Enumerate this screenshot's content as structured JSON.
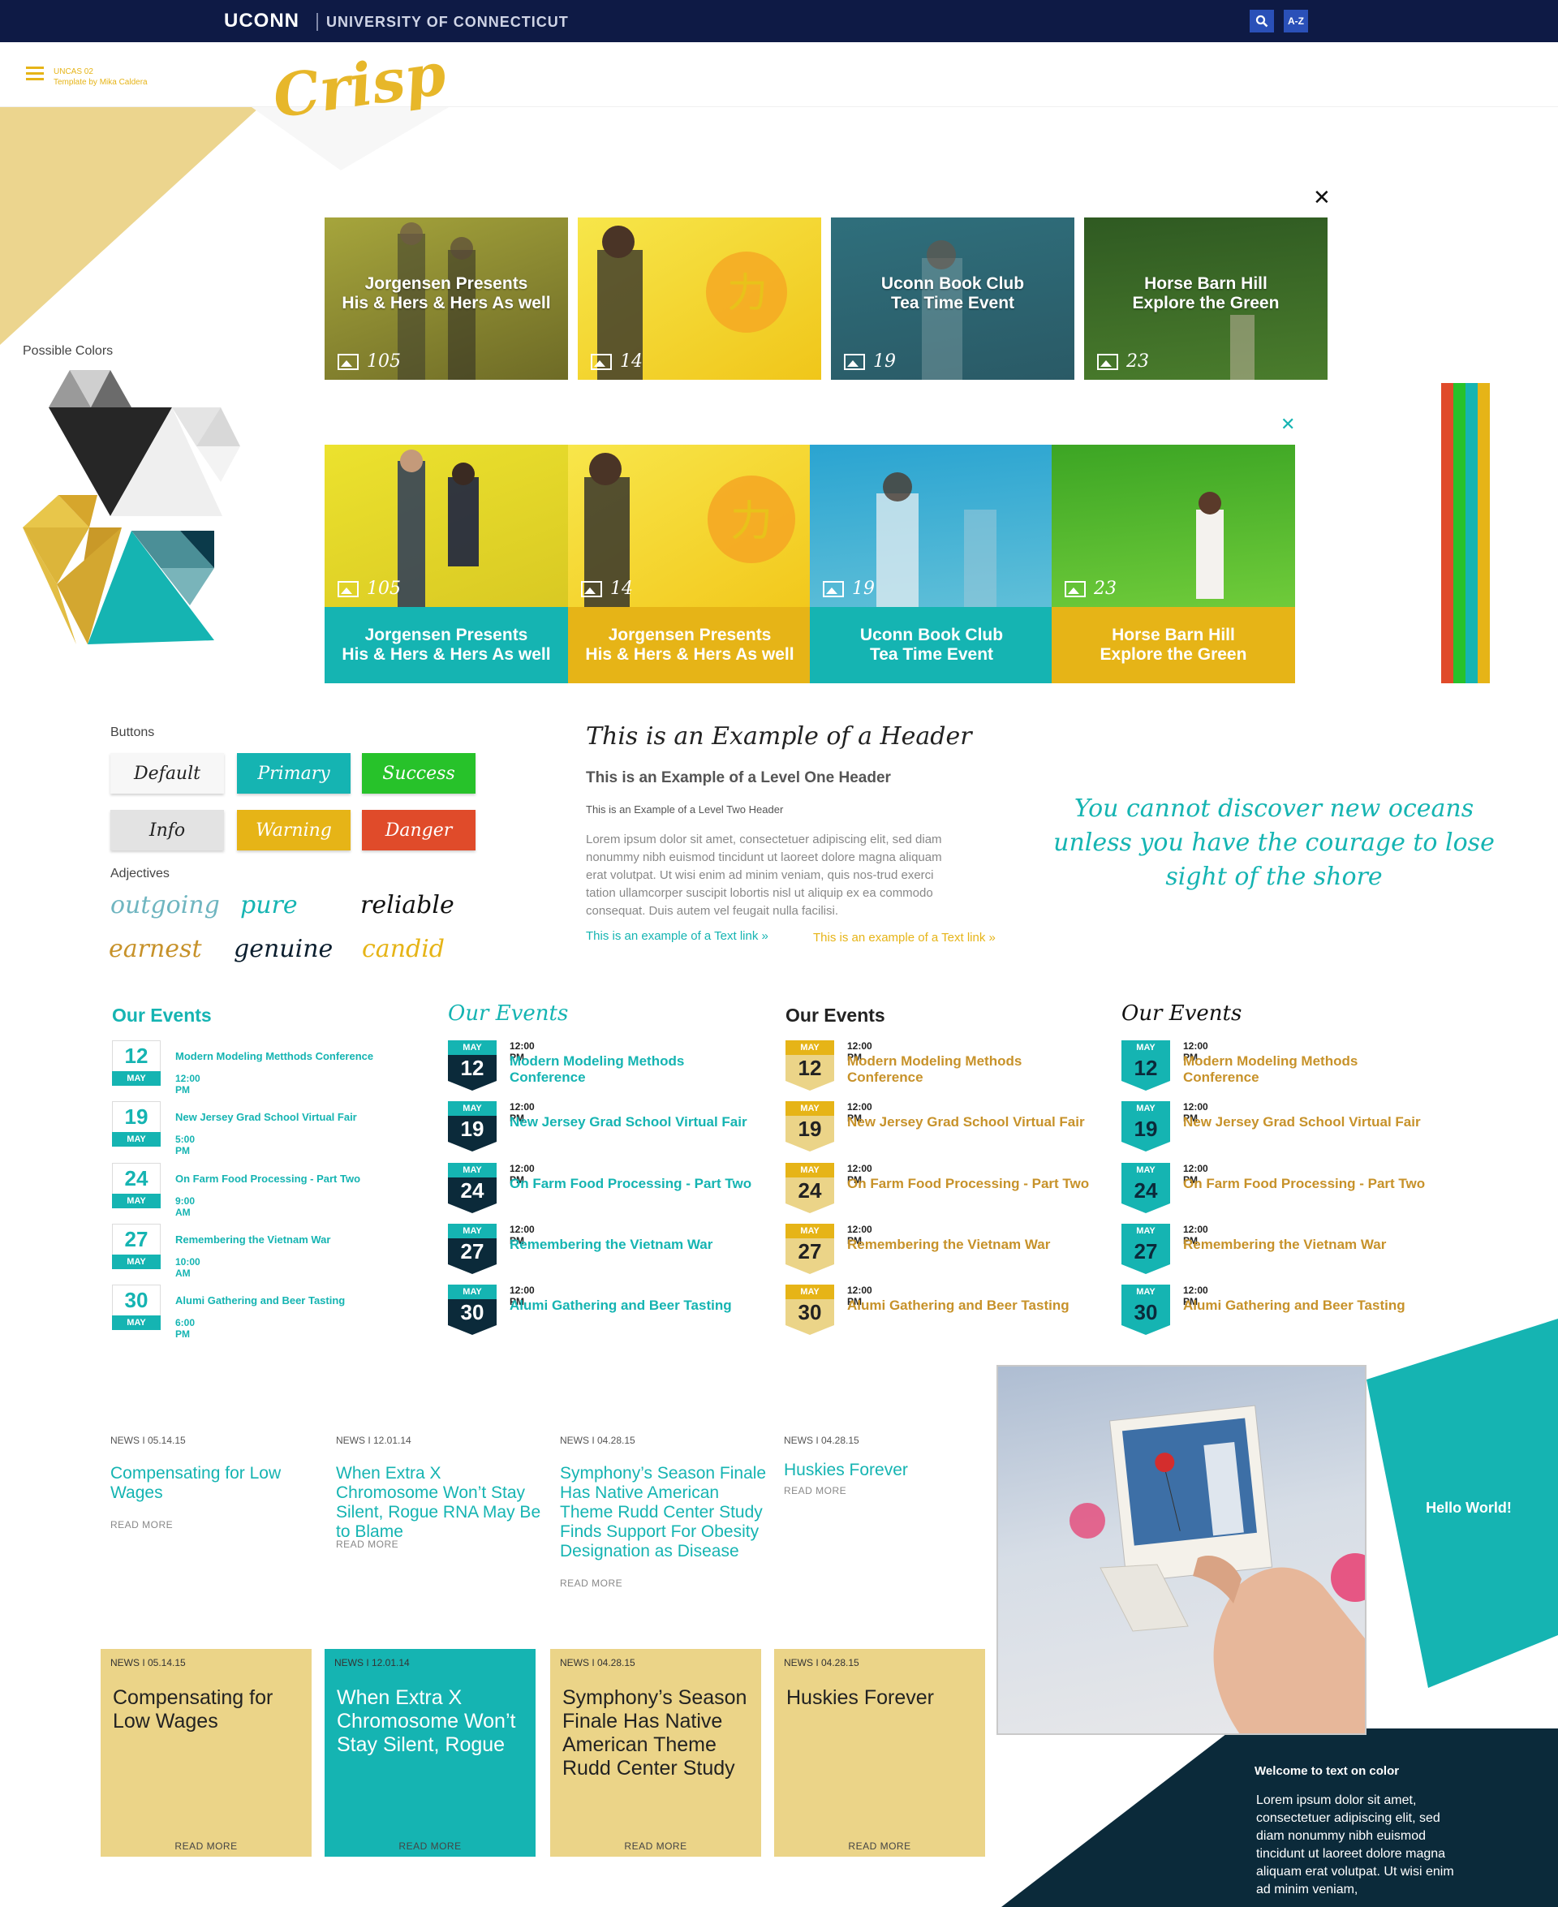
{
  "topbar": {
    "brand": "UCONN",
    "university": "UNIVERSITY OF CONNECTICUT",
    "az_label": "A-Z"
  },
  "header": {
    "site_code": "UNCAS 02",
    "template_credit": "Template by Mika Caldera",
    "logo": "Crisp"
  },
  "colors": {
    "navy": "#0e1a45",
    "teal": "#15b4b2",
    "gold": "#e6b417",
    "green": "#27c22a",
    "red": "#e04b2a",
    "dark_teal": "#0b2a3a"
  },
  "palette": {
    "label": "Possible Colors"
  },
  "tiles_row1": [
    {
      "title1": "Jorgensen Presents",
      "title2": "His & Hers & Hers As well",
      "count": "105",
      "color": "#8d8a2d"
    },
    {
      "title1": "",
      "title2": "",
      "count": "14",
      "color": "#f0d22a"
    },
    {
      "title1": "Uconn Book Club",
      "title2": "Tea Time Event",
      "count": "19",
      "color": "#2f6f7c"
    },
    {
      "title1": "Horse Barn Hill",
      "title2": "Explore the Green",
      "count": "23",
      "color": "#3f6b2a"
    }
  ],
  "tiles_row2": [
    {
      "title1": "Jorgensen Presents",
      "title2": "His & Hers & Hers As well",
      "count": "105",
      "photo": "#e8d925",
      "cap": "#15b4b2"
    },
    {
      "title1": "Jorgensen Presents",
      "title2": "His & Hers & Hers As well",
      "count": "14",
      "photo": "#f3d62f",
      "cap": "#e6b417"
    },
    {
      "title1": "Uconn Book Club",
      "title2": "Tea Time Event",
      "count": "19",
      "photo": "#34a9cf",
      "cap": "#15b4b2"
    },
    {
      "title1": "Horse Barn Hill",
      "title2": "Explore the Green",
      "count": "23",
      "photo": "#4cb42c",
      "cap": "#e6b417"
    }
  ],
  "buttons": {
    "label": "Buttons",
    "default": "Default",
    "primary": "Primary",
    "success": "Success",
    "info": "Info",
    "warning": "Warning",
    "danger": "Danger"
  },
  "adjectives": {
    "label": "Adjectives",
    "words": [
      "outgoing",
      "pure",
      "reliable",
      "earnest",
      "genuine",
      "candid"
    ]
  },
  "typography": {
    "script_header": "This is an Example of a Header",
    "h1": "This is an Example of a Level One Header",
    "h2": "This is an Example of a Level Two Header",
    "paragraph": "Lorem ipsum dolor sit amet, consectetuer adipiscing elit, sed diam nonummy nibh euismod tincidunt ut laoreet dolore magna aliquam erat volutpat. Ut wisi enim ad minim veniam, quis nos-trud exerci tation ullamcorper suscipit lobortis nisl ut aliquip ex ea commodo consequat. Duis autem vel feugait nulla facilisi.",
    "link_teal": "This is an example of a Text link »",
    "link_gold": "This is an example of a Text link »"
  },
  "quote": "You cannot discover new oceans unless you have the courage to lose sight of the shore",
  "events": {
    "title": "Our Events",
    "items": [
      {
        "day": "12",
        "month": "MAY",
        "time": "12:00 PM",
        "name_short": "Modern Modeling Metthods Conference",
        "name": "Modern Modeling Methods Conference"
      },
      {
        "day": "19",
        "month": "MAY",
        "time": "5:00 PM",
        "name_short": "New Jersey Grad School Virtual Fair",
        "name": "New Jersey Grad School Virtual Fair"
      },
      {
        "day": "24",
        "month": "MAY",
        "time": "9:00 AM",
        "name_short": "On Farm Food Processing - Part Two",
        "name": "On Farm Food Processing - Part Two"
      },
      {
        "day": "27",
        "month": "MAY",
        "time": "10:00 AM",
        "name_short": "Remembering the Vietnam War",
        "name": "Remembering the Vietnam War"
      },
      {
        "day": "30",
        "month": "MAY",
        "time": "6:00 PM",
        "name_short": "Alumi Gathering and Beer Tasting",
        "name": "Alumi Gathering and Beer Tasting"
      }
    ],
    "list_time": "12:00 PM"
  },
  "news": {
    "items": [
      {
        "meta": "NEWS I 05.14.15",
        "title": "Compensating for Low Wages",
        "more": "READ MORE"
      },
      {
        "meta": "NEWS I 12.01.14",
        "title": "When Extra X Chromosome Won’t Stay Silent, Rogue RNA May Be to Blame",
        "more": "READ MORE"
      },
      {
        "meta": "NEWS I 04.28.15",
        "title": "Symphony’s Season Finale Has Native American Theme Rudd Center Study Finds Support For Obesity Designation as Disease",
        "more": "READ MORE"
      },
      {
        "meta": "NEWS I 04.28.15",
        "title": "Huskies Forever",
        "more": "READ MORE"
      }
    ],
    "cards": [
      {
        "meta": "NEWS I 05.14.15",
        "title": "Compensating for Low Wages",
        "more": "READ MORE",
        "bg": "#ebd488"
      },
      {
        "meta": "NEWS I 12.01.14",
        "title": "When Extra X Chromosome Won’t Stay Silent, Rogue",
        "more": "READ MORE",
        "bg": "#15b4b2"
      },
      {
        "meta": "NEWS I 04.28.15",
        "title": "Symphony’s Season Finale Has Native American Theme Rudd Center Study",
        "more": "READ MORE",
        "bg": "#ebd488"
      },
      {
        "meta": "NEWS I 04.28.15",
        "title": "Huskies Forever",
        "more": "READ MORE",
        "bg": "#ebd488"
      }
    ]
  },
  "feature": {
    "hello": "Hello World!",
    "welcome_title": "Welcome to text on color",
    "welcome_text": "Lorem ipsum dolor sit amet, consectetuer adipiscing elit, sed diam nonummy nibh euismod tincidunt ut laoreet dolore magna aliquam erat volutpat. Ut wisi enim ad minim veniam,"
  }
}
